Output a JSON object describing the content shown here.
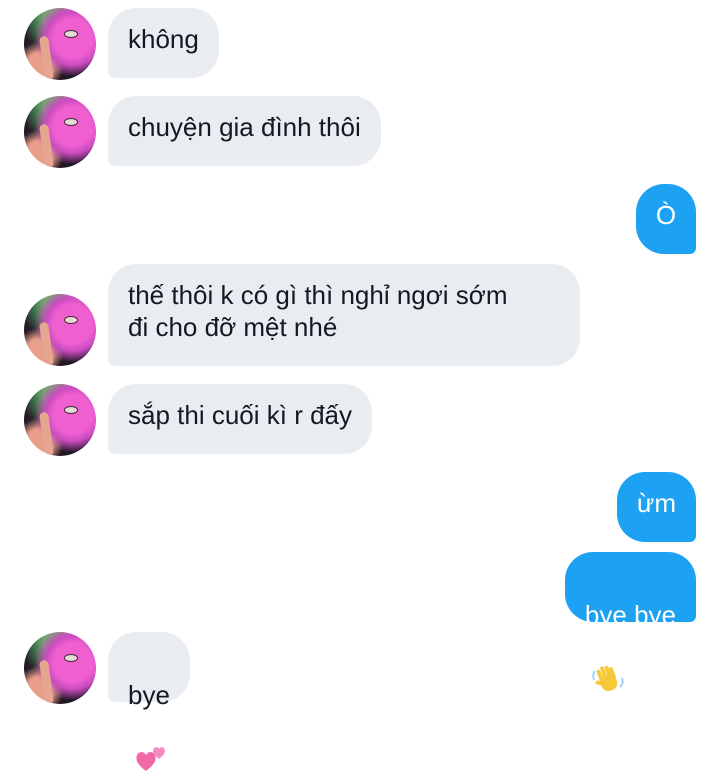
{
  "conversation": {
    "messages": [
      {
        "side": "in",
        "text": "không",
        "emoji": ""
      },
      {
        "side": "in",
        "text": "chuyện gia đình thôi",
        "emoji": ""
      },
      {
        "side": "out",
        "text": "Ò",
        "emoji": ""
      },
      {
        "side": "in",
        "text": "thế thôi k có gì thì nghỉ ngơi sớm\nđi cho đỡ mệt nhé",
        "emoji": ""
      },
      {
        "side": "in",
        "text": "sắp thi cuối kì r đấy",
        "emoji": ""
      },
      {
        "side": "out",
        "text": "ừm",
        "emoji": ""
      },
      {
        "side": "out",
        "text": "bye bye",
        "emoji": "waving-hand-emoji"
      },
      {
        "side": "in",
        "text": "bye",
        "emoji": "two-hearts-emoji"
      }
    ]
  },
  "colors": {
    "incoming_bubble": "#e9edf1",
    "outgoing_bubble": "#1da1f2",
    "incoming_text": "#141823",
    "outgoing_text": "#ffffff"
  }
}
